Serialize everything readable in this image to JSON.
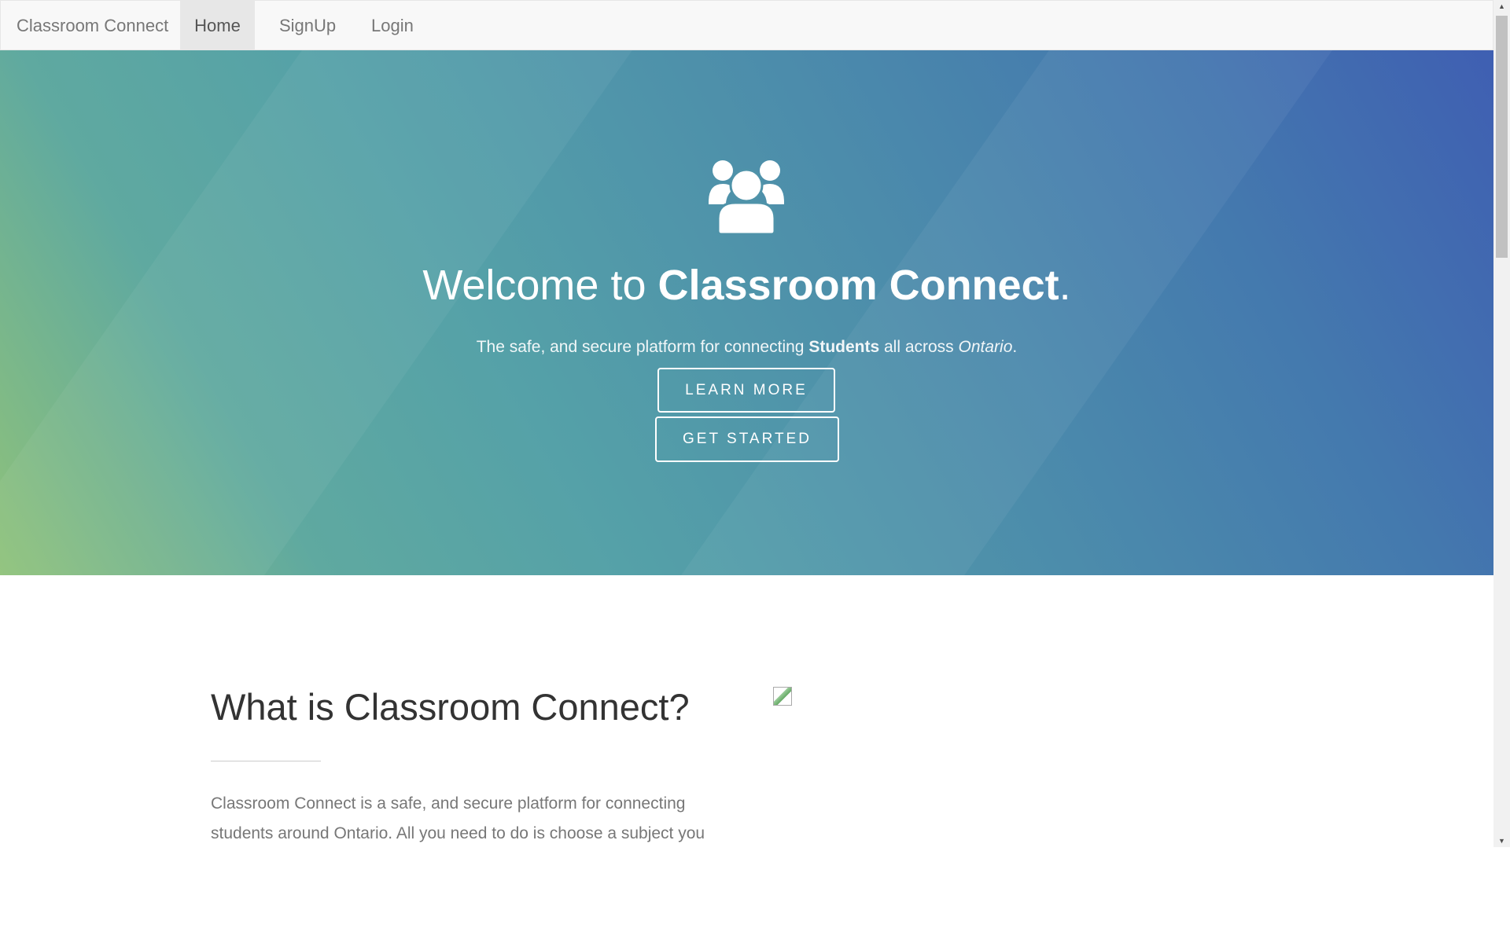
{
  "nav": {
    "brand": "Classroom Connect",
    "items": [
      {
        "label": "Home",
        "active": true
      },
      {
        "label": "SignUp"
      },
      {
        "label": "Login"
      }
    ]
  },
  "hero": {
    "icon": "users-icon",
    "title_prefix": "Welcome to ",
    "title_bold": "Classroom Connect",
    "title_suffix": ".",
    "sub_prefix": "The safe, and secure platform for connecting ",
    "sub_bold": "Students",
    "sub_mid": " all across ",
    "sub_italic": "Ontario",
    "sub_suffix": ".",
    "learn_more": "LEARN MORE",
    "get_started": "GET STARTED"
  },
  "about": {
    "heading": "What is Classroom Connect?",
    "paragraph": "Classroom Connect is a safe, and secure platform for connecting students around Ontario. All you need to do is choose a subject you"
  }
}
